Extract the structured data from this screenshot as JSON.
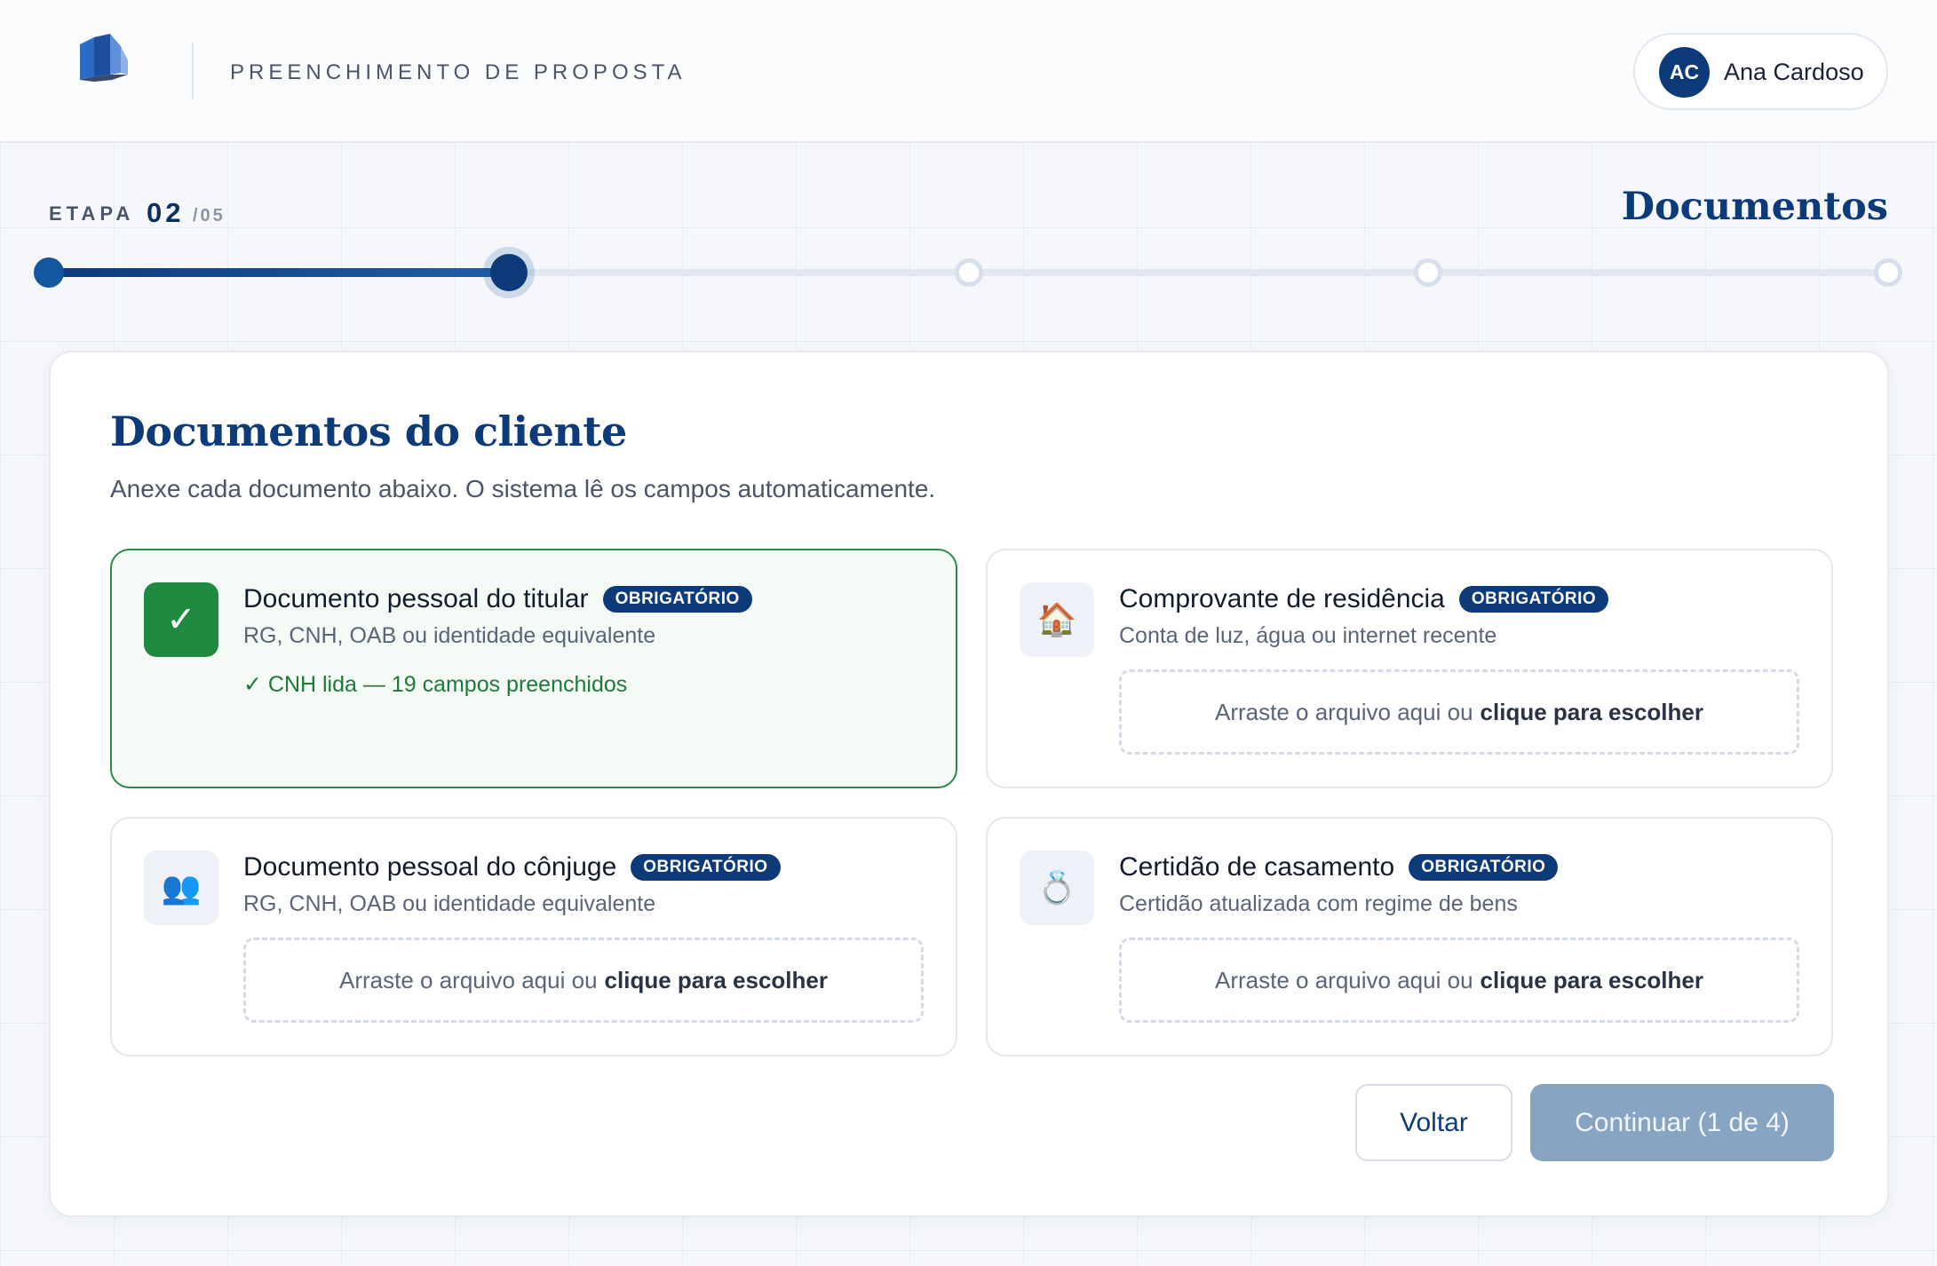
{
  "header": {
    "title": "PREENCHIMENTO DE PROPOSTA",
    "user": {
      "initials": "AC",
      "name": "Ana Cardoso"
    }
  },
  "stepper": {
    "label": "ETAPA",
    "current": "02",
    "total": "/05",
    "step_name": "Documentos",
    "progress_fraction": 0.25,
    "steps_total": 5,
    "steps_done": 2
  },
  "main": {
    "title": "Documentos do cliente",
    "subtitle": "Anexe cada documento abaixo. O sistema lê os campos automaticamente.",
    "documents": [
      {
        "title": "Documento pessoal do titular",
        "badge": "OBRIGATÓRIO",
        "description": "RG, CNH, OAB ou identidade equivalente",
        "status": "✓ CNH lida — 19 campos preenchidos",
        "icon": "✓",
        "icon_name": "check-icon"
      },
      {
        "title": "Comprovante de residência",
        "badge": "OBRIGATÓRIO",
        "description": "Conta de luz, água ou internet recente",
        "icon": "🏠",
        "icon_name": "house-icon"
      },
      {
        "title": "Documento pessoal do cônjuge",
        "badge": "OBRIGATÓRIO",
        "description": "RG, CNH, OAB ou identidade equivalente",
        "icon": "👥",
        "icon_name": "couple-icon"
      },
      {
        "title": "Certidão de casamento",
        "badge": "OBRIGATÓRIO",
        "description": "Certidão atualizada com regime de bens",
        "icon": "💍",
        "icon_name": "ring-icon"
      }
    ],
    "dropzone": {
      "text": "Arraste o arquivo aqui ou",
      "action": "clique para escolher"
    },
    "buttons": {
      "back": "Voltar",
      "next": "Continuar (1 de 4)"
    }
  },
  "colors": {
    "primary": "#0d3b7a",
    "success": "#1f8a3f",
    "disabled_button": "#88a4c3"
  }
}
